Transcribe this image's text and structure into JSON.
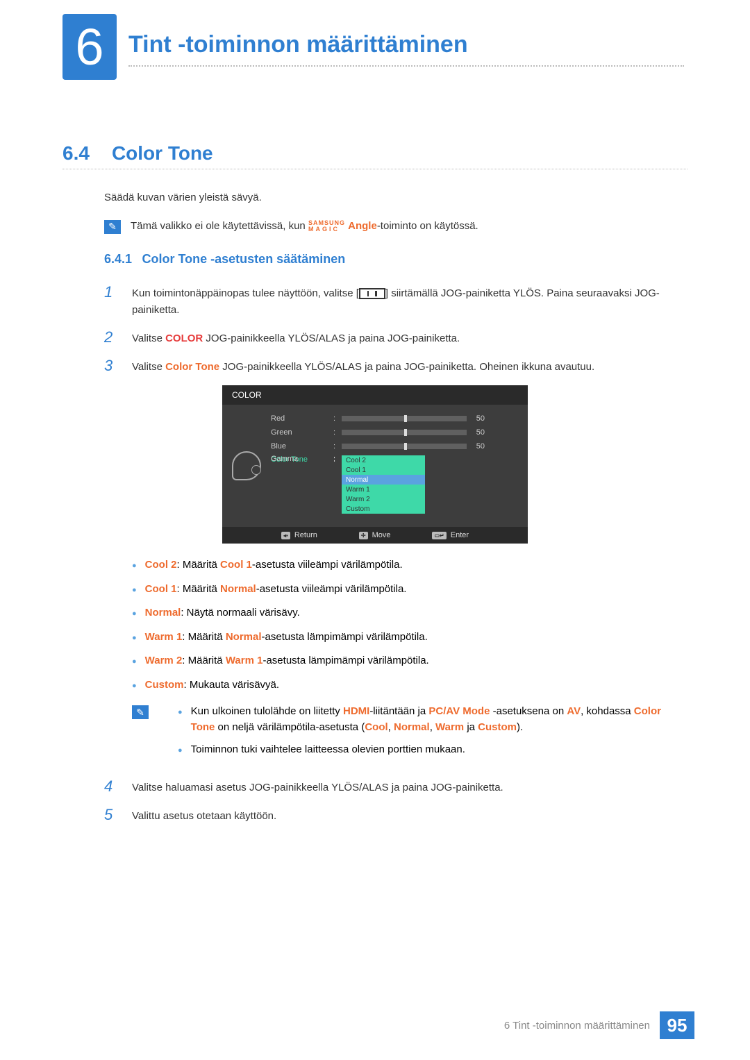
{
  "chapter": {
    "number": "6",
    "title": "Tint -toiminnon määrittäminen"
  },
  "section": {
    "number": "6.4",
    "title": "Color Tone"
  },
  "intro": "Säädä kuvan värien yleistä sävyä.",
  "note1": {
    "pre": "Tämä valikko ei ole käytettävissä, kun ",
    "magic_top": "SAMSUNG",
    "magic_bot": "MAGIC",
    "angle": "Angle",
    "post": "-toiminto on käytössä."
  },
  "subsection": {
    "number": "6.4.1",
    "title": "Color Tone -asetusten säätäminen"
  },
  "steps": {
    "s1a": "Kun toimintonäppäinopas tulee näyttöön, valitse [",
    "s1b": "] siirtämällä JOG-painiketta YLÖS. Paina seuraavaksi JOG-painiketta.",
    "s2a": "Valitse ",
    "s2_color": "COLOR",
    "s2b": " JOG-painikkeella YLÖS/ALAS ja paina JOG-painiketta.",
    "s3a": "Valitse ",
    "s3_ct": "Color Tone",
    "s3b": " JOG-painikkeella YLÖS/ALAS ja paina JOG-painiketta. Oheinen ikkuna avautuu.",
    "s4": "Valitse haluamasi asetus JOG-painikkeella YLÖS/ALAS ja paina JOG-painiketta.",
    "s5": "Valittu asetus otetaan käyttöön."
  },
  "osd": {
    "title": "COLOR",
    "rows": {
      "red": "Red",
      "green": "Green",
      "blue": "Blue",
      "colortone": "Color Tone",
      "gamma": "Gamma",
      "v50": "50"
    },
    "options": [
      "Cool 2",
      "Cool 1",
      "Normal",
      "Warm 1",
      "Warm 2",
      "Custom"
    ],
    "footer": {
      "return": "Return",
      "move": "Move",
      "enter": "Enter"
    }
  },
  "bullets": [
    {
      "term": "Cool 2",
      "mid": ": Määritä ",
      "ref": "Cool 1",
      "tail": "-asetusta viileämpi värilämpötila."
    },
    {
      "term": "Cool 1",
      "mid": ": Määritä ",
      "ref": "Normal",
      "tail": "-asetusta viileämpi värilämpötila."
    },
    {
      "term": "Normal",
      "mid": ": Näytä normaali värisävy.",
      "ref": "",
      "tail": ""
    },
    {
      "term": "Warm 1",
      "mid": ": Määritä ",
      "ref": "Normal",
      "tail": "-asetusta lämpimämpi värilämpötila."
    },
    {
      "term": "Warm 2",
      "mid": ": Määritä ",
      "ref": "Warm 1",
      "tail": "-asetusta lämpimämpi värilämpötila."
    },
    {
      "term": "Custom",
      "mid": ": Mukauta värisävyä.",
      "ref": "",
      "tail": ""
    }
  ],
  "subnote": {
    "l1a": "Kun ulkoinen tulolähde on liitetty ",
    "hdmi": "HDMI",
    "l1b": "-liitäntään ja ",
    "pcav": "PC/AV Mode",
    "l1c": " -asetuksena on ",
    "av": "AV",
    "l1d": ", kohdassa ",
    "ct": "Color Tone",
    "l1e": " on neljä värilämpötila-asetusta (",
    "cool": "Cool",
    "comma1": ", ",
    "normal": "Normal",
    "comma2": ", ",
    "warm": "Warm",
    "ja": " ja ",
    "custom": "Custom",
    "paren": ").",
    "l2": "Toiminnon tuki vaihtelee laitteessa olevien porttien mukaan."
  },
  "footer": {
    "text": "6 Tint -toiminnon määrittäminen",
    "page": "95"
  }
}
